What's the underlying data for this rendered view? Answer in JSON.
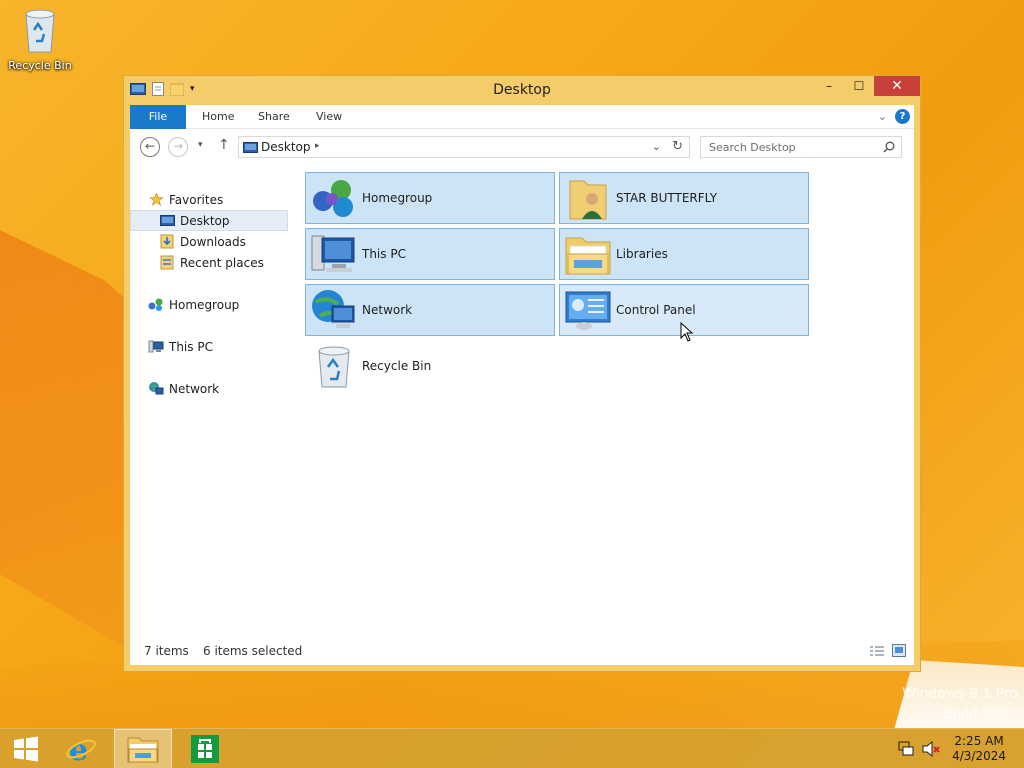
{
  "desktop": {
    "recycle_bin_label": "Recycle Bin",
    "watermark_line1": "Windows 8.1 Pro",
    "watermark_line2": "Build 9600"
  },
  "window": {
    "title": "Desktop",
    "minimize": "–",
    "maximize": "☐",
    "close": "✕"
  },
  "ribbon": {
    "tabs": [
      "File",
      "Home",
      "Share",
      "View"
    ],
    "help_label": "?"
  },
  "navigation": {
    "address_text": "Desktop",
    "search_placeholder": "Search Desktop"
  },
  "navpane": {
    "favorites": "Favorites",
    "desktop": "Desktop",
    "downloads": "Downloads",
    "recent_places": "Recent places",
    "homegroup": "Homegroup",
    "this_pc": "This PC",
    "network": "Network"
  },
  "items": [
    {
      "label": "Homegroup",
      "icon": "homegroup-icon",
      "selected": true
    },
    {
      "label": "STAR BUTTERFLY",
      "icon": "user-folder-icon",
      "selected": true
    },
    {
      "label": "This PC",
      "icon": "computer-icon",
      "selected": true
    },
    {
      "label": "Libraries",
      "icon": "libraries-icon",
      "selected": true
    },
    {
      "label": "Network",
      "icon": "network-icon",
      "selected": true
    },
    {
      "label": "Control Panel",
      "icon": "control-panel-icon",
      "selected": true
    },
    {
      "label": "Recycle Bin",
      "icon": "recycle-bin-icon",
      "selected": false
    }
  ],
  "status": {
    "count": "7 items",
    "selected": "6 items selected"
  },
  "taskbar": {
    "time": "2:25 AM",
    "date": "4/3/2024"
  },
  "colors": {
    "accent": "#1979ca",
    "window_frame": "#f4cd6a",
    "selection": "#cce4f6",
    "close_button": "#c7403a"
  }
}
